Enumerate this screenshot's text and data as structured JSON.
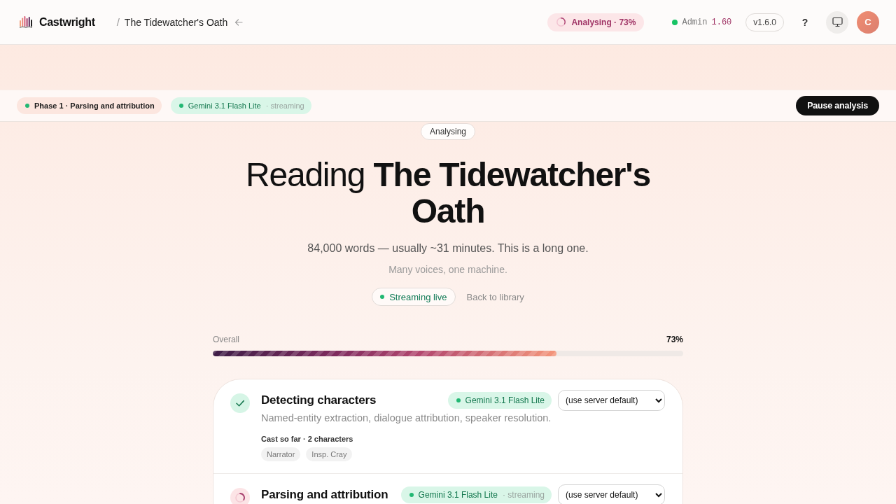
{
  "header": {
    "brand": "Castwright",
    "separator": "/",
    "book_title": "The Tidewatcher's Oath",
    "status": "Analysing · 73%",
    "user": {
      "role": "Admin",
      "value": "1.60"
    },
    "version": "v1.6.0",
    "help": "?",
    "avatar_initial": "C"
  },
  "phase_bar": {
    "phase": "Phase 1 · Parsing and attribution",
    "model": {
      "name": "Gemini 3.1 Flash Lite",
      "note": "· streaming"
    },
    "pause_button": "Pause analysis"
  },
  "hero": {
    "badge": "Analysing",
    "title": "Reading **The Tidewatcher's Oath**",
    "subtitle": "84,000 words — usually ~31 minutes. This is a long one.",
    "tagline": "Many voices, one machine.",
    "actions": [
      {
        "kind": "status",
        "label": "Streaming live"
      },
      {
        "kind": "link",
        "label": "Back to library"
      }
    ]
  },
  "overall": {
    "label": "Overall",
    "reading": "73%",
    "level": 0.73
  },
  "stages": [
    {
      "kind": "done",
      "title": "Detecting characters",
      "model": {
        "name": "Gemini 3.1 Flash Lite"
      },
      "model_choice": "(use server default)",
      "description": "Named-entity extraction, dialogue attribution, speaker resolution.",
      "cast": {
        "label": "Cast so far · 2 characters",
        "names": [
          "Narrator",
          "Insp. Cray"
        ]
      }
    },
    {
      "kind": "running",
      "title": "Parsing and attribution",
      "model": {
        "name": "Gemini 3.1 Flash Lite",
        "note": "· streaming"
      },
      "model_choice": "(use server default)"
    }
  ]
}
